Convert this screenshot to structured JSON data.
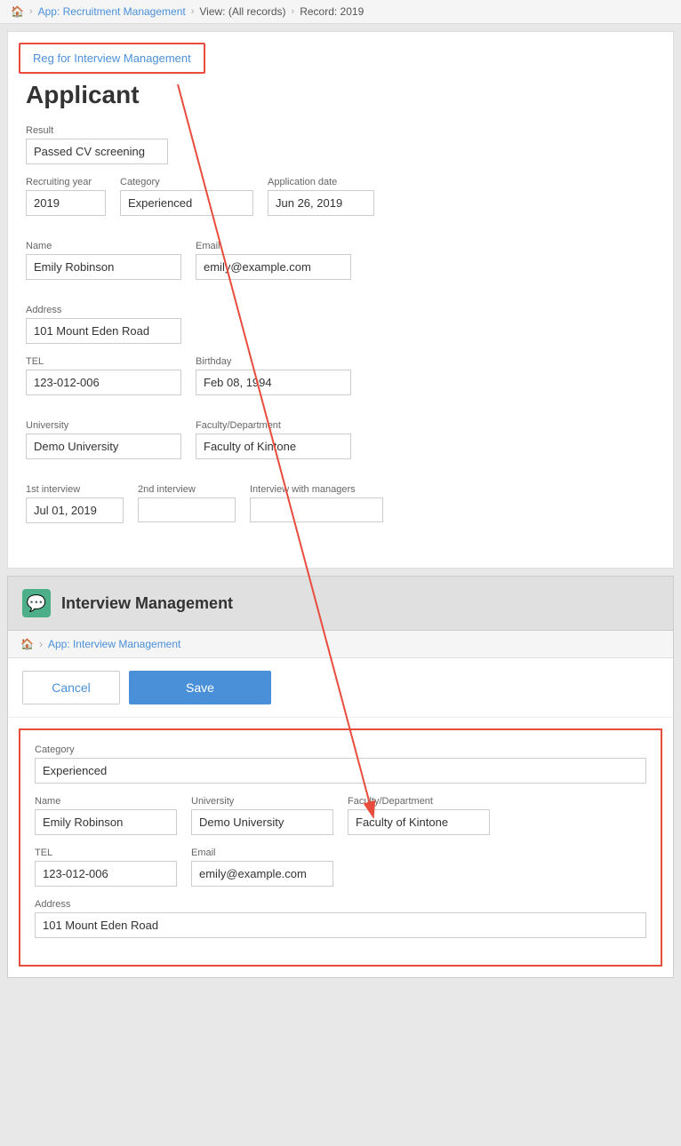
{
  "breadcrumb": {
    "home_icon": "🏠",
    "app_label": "App: Recruitment Management",
    "view_label": "View: (All records)",
    "record_label": "Record: 2019"
  },
  "reg_button": {
    "label": "Reg for Interview Management"
  },
  "applicant": {
    "title": "Applicant",
    "result_label": "Result",
    "result_value": "Passed CV screening",
    "recruiting_year_label": "Recruiting year",
    "recruiting_year_value": "2019",
    "category_label": "Category",
    "category_value": "Experienced",
    "application_date_label": "Application date",
    "application_date_value": "Jun 26, 2019",
    "name_label": "Name",
    "name_value": "Emily Robinson",
    "email_label": "Email",
    "email_value": "emily@example.com",
    "address_label": "Address",
    "address_value": "101 Mount Eden Road",
    "tel_label": "TEL",
    "tel_value": "123-012-006",
    "birthday_label": "Birthday",
    "birthday_value": "Feb 08, 1994",
    "university_label": "University",
    "university_value": "Demo University",
    "faculty_label": "Faculty/Department",
    "faculty_value": "Faculty of Kintone",
    "first_interview_label": "1st interview",
    "first_interview_value": "Jul 01, 2019",
    "second_interview_label": "2nd interview",
    "second_interview_value": "",
    "manager_interview_label": "Interview with managers",
    "manager_interview_value": ""
  },
  "interview_management": {
    "header_title": "Interview Management",
    "breadcrumb_home": "🏠",
    "breadcrumb_app": "App: Interview Management",
    "cancel_label": "Cancel",
    "save_label": "Save",
    "category_label": "Category",
    "category_value": "Experienced",
    "name_label": "Name",
    "name_value": "Emily Robinson",
    "university_label": "University",
    "university_value": "Demo University",
    "faculty_label": "Faculty/Department",
    "faculty_value": "Faculty of Kintone",
    "tel_label": "TEL",
    "tel_value": "123-012-006",
    "email_label": "Email",
    "email_value": "emily@example.com",
    "address_label": "Address",
    "address_value": "101 Mount Eden Road"
  }
}
